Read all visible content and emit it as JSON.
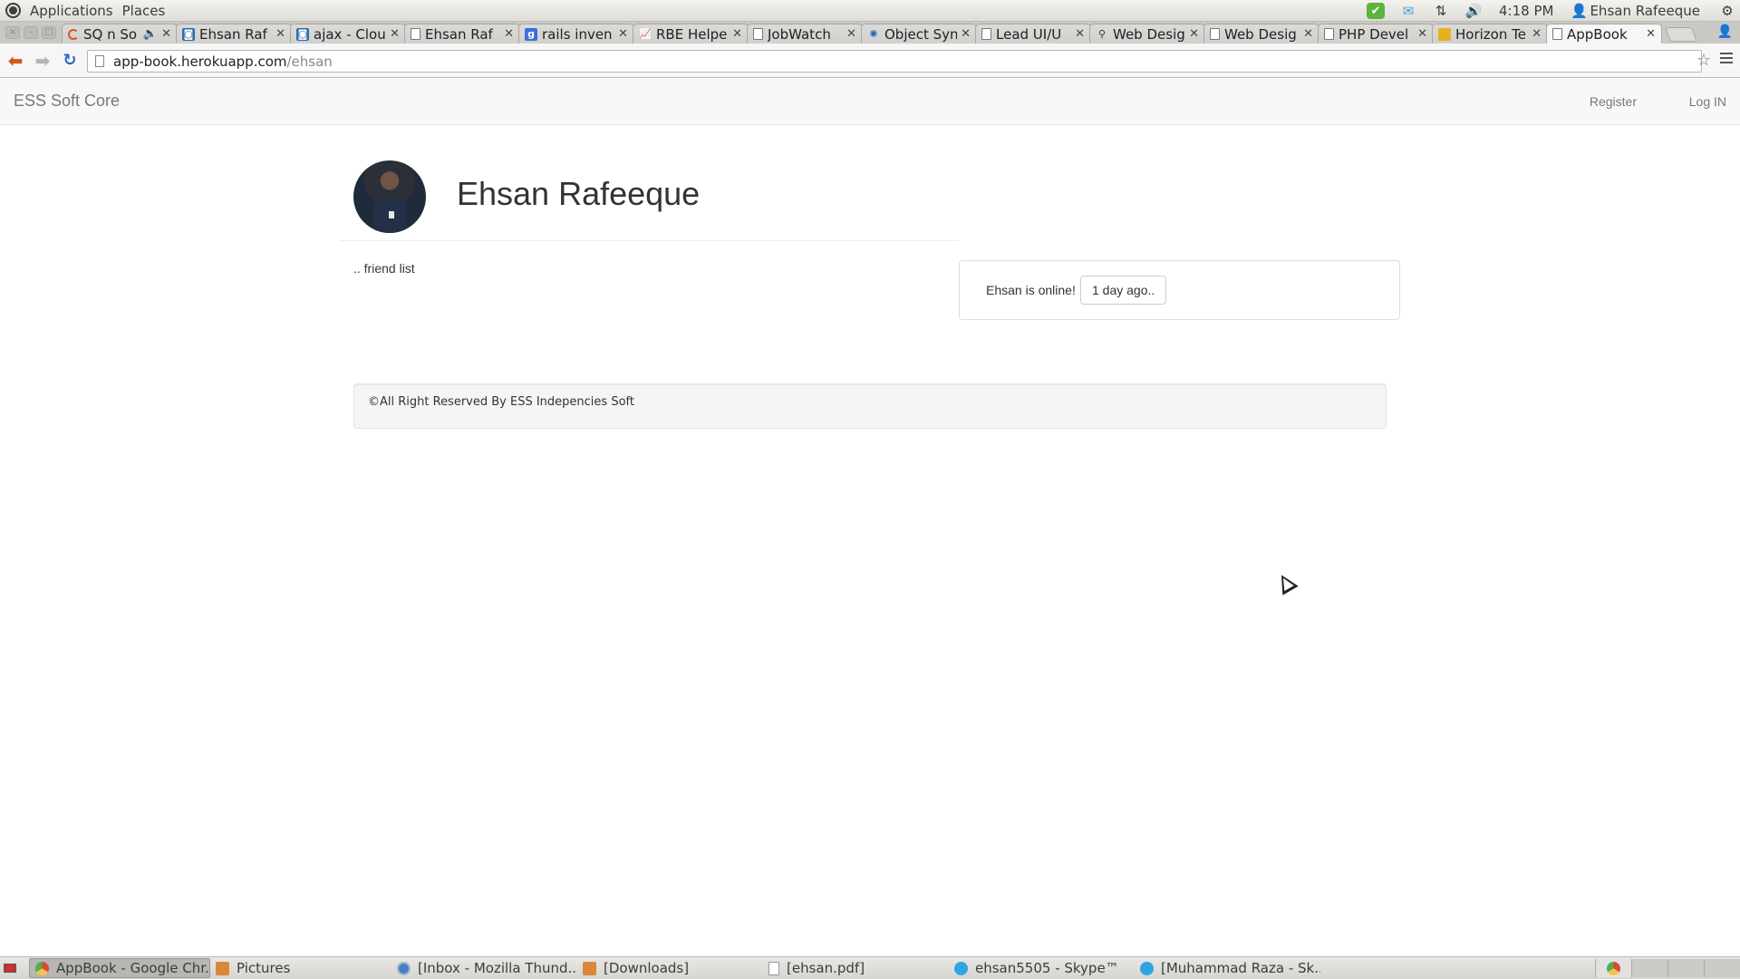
{
  "top_panel": {
    "menus": [
      "Applications",
      "Places"
    ],
    "clock": "4:18 PM",
    "user": "Ehsan Rafeeque"
  },
  "tabs": [
    {
      "title": "SQ n So",
      "icon": "loading-icon"
    },
    {
      "title": "Ehsan Raf",
      "icon": "site-icon"
    },
    {
      "title": "ajax - Clou",
      "icon": "site-icon"
    },
    {
      "title": "Ehsan Raf",
      "icon": "page-icon"
    },
    {
      "title": "rails inven",
      "icon": "google-icon"
    },
    {
      "title": "RBE Helpe",
      "icon": "chart-icon"
    },
    {
      "title": "JobWatch",
      "icon": "page-icon"
    },
    {
      "title": "Object Syn",
      "icon": "gear-icon"
    },
    {
      "title": "Lead UI/U",
      "icon": "page-icon"
    },
    {
      "title": "Web Desig",
      "icon": "pin-icon"
    },
    {
      "title": "Web Desig",
      "icon": "page-icon"
    },
    {
      "title": "PHP Devel",
      "icon": "page-icon"
    },
    {
      "title": "Horizon Te",
      "icon": "site-icon"
    },
    {
      "title": "AppBook",
      "icon": "page-icon",
      "active": true
    }
  ],
  "address_bar": {
    "host": "app-book.herokuapp.com",
    "path": "/ehsan"
  },
  "page": {
    "brand": "ESS Soft Core",
    "nav": {
      "register": "Register",
      "login": "Log IN"
    },
    "profile_name": "Ehsan Rafeeque",
    "friend_list": ".. friend list",
    "status_text": "Ehsan is online!",
    "status_time": "1 day ago..",
    "footer": "©All Right Reserved By ESS Indepencies Soft"
  },
  "taskbar": {
    "items": [
      {
        "label": "AppBook - Google Chr...",
        "icon": "chrome-icon",
        "active": true
      },
      {
        "label": "Pictures",
        "icon": "folder-icon"
      },
      {
        "label": "[Inbox - Mozilla Thund...",
        "icon": "thunderbird-icon"
      },
      {
        "label": "[Downloads]",
        "icon": "folder-icon"
      },
      {
        "label": "[ehsan.pdf]",
        "icon": "document-icon"
      },
      {
        "label": "ehsan5505 - Skype™",
        "icon": "skype-icon"
      },
      {
        "label": "[Muhammad Raza - Sk...",
        "icon": "chat-icon"
      }
    ]
  }
}
